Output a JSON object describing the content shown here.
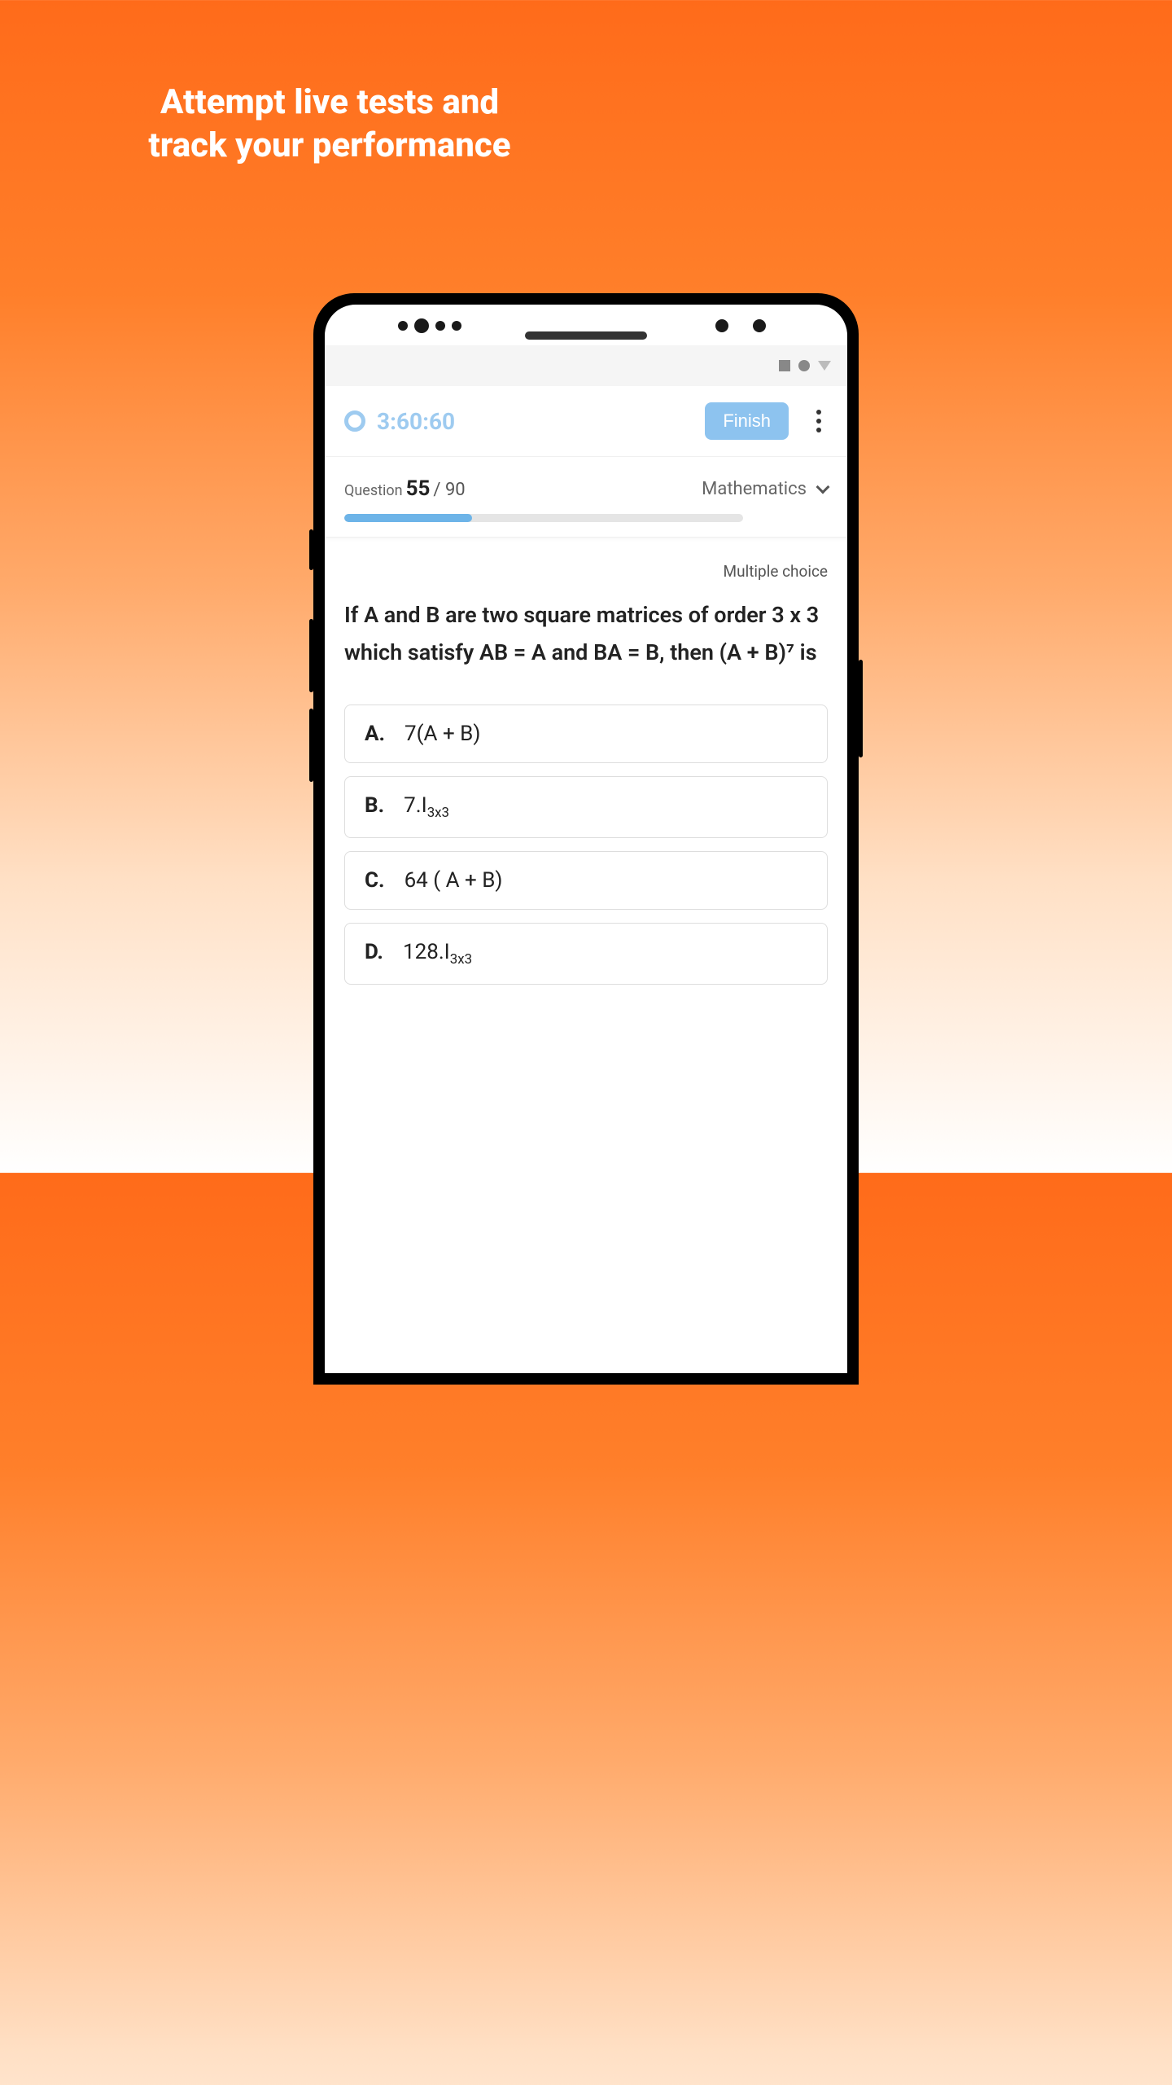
{
  "hero": {
    "line1": "Attempt live tests and",
    "line2": "track your performance"
  },
  "timer": "3:60:60",
  "finish_label": "Finish",
  "question": {
    "label": "Question",
    "current": "55",
    "total": "/ 90",
    "subject": "Mathematics",
    "progress_percent": 32,
    "type": "Multiple choice",
    "text": "If A and B are two square matrices of order 3 x 3 which satisfy AB = A and BA = B, then (A + B)⁷ is"
  },
  "options": [
    {
      "letter": "A.",
      "text": "7(A + B)",
      "has_sub": false
    },
    {
      "letter": "B.",
      "text": "7.I",
      "sub": "3x3",
      "has_sub": true
    },
    {
      "letter": "C.",
      "text": "64 ( A + B)",
      "has_sub": false
    },
    {
      "letter": "D.",
      "text": "128.I",
      "sub": "3x3",
      "has_sub": true
    }
  ]
}
